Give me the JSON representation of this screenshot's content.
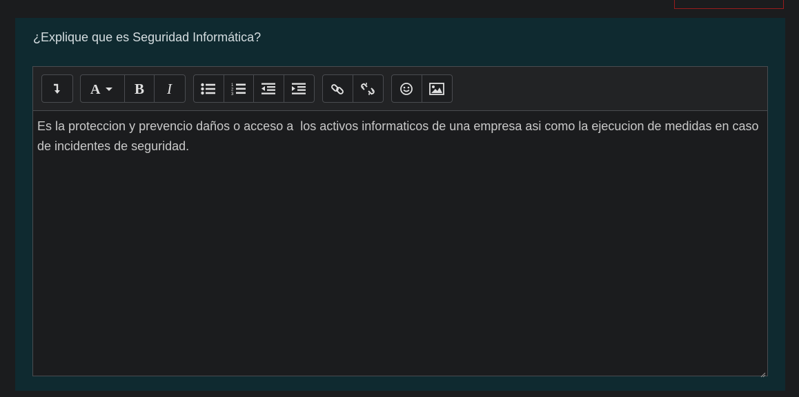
{
  "question": {
    "text": "¿Explique que es Seguridad Informática?"
  },
  "toolbar": {
    "groups": [
      {
        "buttons": [
          {
            "icon": "collapse-toolbar-icon"
          }
        ]
      },
      {
        "buttons": [
          {
            "icon": "font-size-icon"
          },
          {
            "icon": "bold-icon"
          },
          {
            "icon": "italic-icon"
          }
        ]
      },
      {
        "buttons": [
          {
            "icon": "unordered-list-icon"
          },
          {
            "icon": "ordered-list-icon"
          },
          {
            "icon": "outdent-icon"
          },
          {
            "icon": "indent-icon"
          }
        ]
      },
      {
        "buttons": [
          {
            "icon": "link-icon"
          },
          {
            "icon": "unlink-icon"
          }
        ]
      },
      {
        "buttons": [
          {
            "icon": "emoji-icon"
          },
          {
            "icon": "image-icon"
          }
        ]
      }
    ]
  },
  "editor": {
    "content": "Es la proteccion y prevencio daños o acceso a  los activos informaticos de una empresa asi como la ejecucion de medidas en caso de incidentes de seguridad."
  },
  "colors": {
    "panel_background": "#0f2a30",
    "page_background": "#1b1c1e",
    "editor_border": "#4a4c50",
    "alert_border": "#9b1c1c"
  }
}
